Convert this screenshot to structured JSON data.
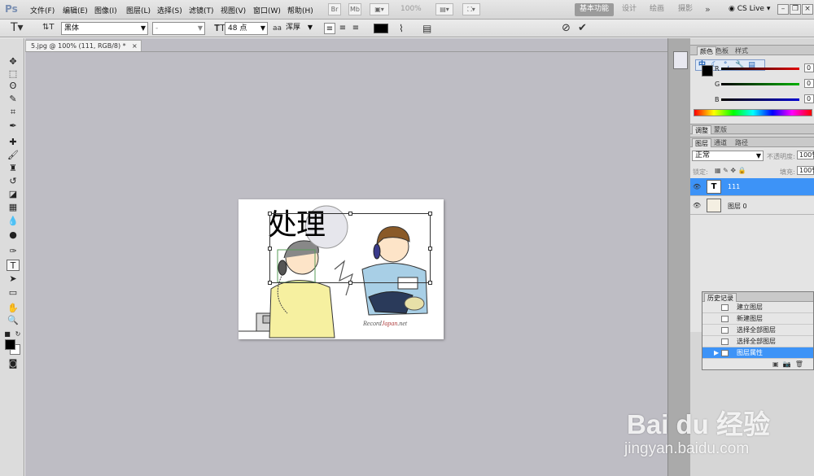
{
  "app": {
    "logo": "Ps"
  },
  "menu": [
    "文件(F)",
    "编辑(E)",
    "图像(I)",
    "图层(L)",
    "选择(S)",
    "滤镜(T)",
    "视图(V)",
    "窗口(W)",
    "帮助(H)"
  ],
  "menubar_tools": {
    "zoom": "100%"
  },
  "workspaces": {
    "items": [
      "基本功能",
      "设计",
      "绘画",
      "摄影"
    ],
    "active": "基本功能",
    "more": "»"
  },
  "cs_live": "CS Live",
  "options": {
    "font_family": "黑体",
    "font_style": "-",
    "font_size": "48 点",
    "anti_alias_prefix": "aa",
    "anti_alias": "浑厚",
    "text_color": "#000000"
  },
  "document": {
    "tab_title": "5.jpg @ 100% (111, RGB/8) *",
    "tab_close": "×",
    "text_layer_content": "处理",
    "image_watermark": {
      "prefix": "Record",
      "cursive": "Japan",
      "suffix": ".net"
    }
  },
  "color_panel": {
    "tabs": [
      "颜色",
      "色板",
      "样式"
    ],
    "channels": [
      {
        "label": "R",
        "value": "0",
        "color": "#e00000"
      },
      {
        "label": "G",
        "value": "0",
        "color": "#00b000"
      },
      {
        "label": "B",
        "value": "0",
        "color": "#0000d0"
      }
    ]
  },
  "ime_toolbar": {
    "lang": "中"
  },
  "adjust_panel": {
    "tabs": [
      "调整",
      "蒙版"
    ]
  },
  "layers_panel": {
    "tabs": [
      "图层",
      "通道",
      "路径"
    ],
    "blend_mode": "正常",
    "opacity_label": "不透明度:",
    "opacity": "100%",
    "lock_label": "锁定:",
    "fill_label": "填充:",
    "fill": "100%",
    "layers": [
      {
        "name": "111",
        "thumb": "T",
        "selected": true
      },
      {
        "name": "图层 0",
        "thumb": "",
        "selected": false
      }
    ]
  },
  "history_panel": {
    "title": "历史记录",
    "items": [
      "建立图层",
      "新建图层",
      "选择全部图层",
      "选择全部图层",
      "图层属性"
    ],
    "selected_index": 4
  },
  "site_watermark": {
    "logo": "Bai du 经验",
    "url": "jingyan.baidu.com"
  }
}
